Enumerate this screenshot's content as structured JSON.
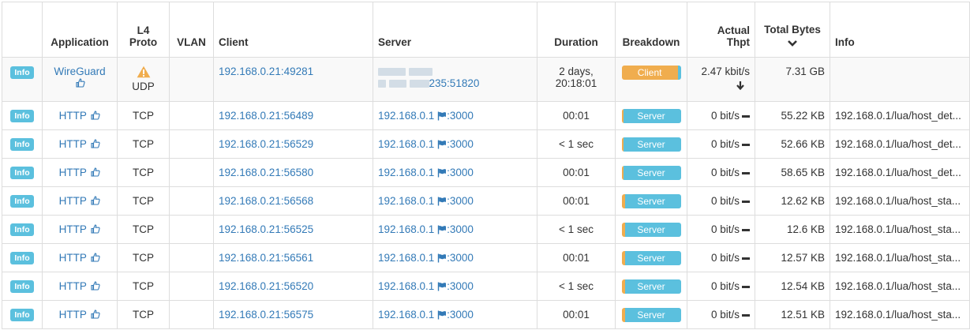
{
  "columns": {
    "application": "Application",
    "l4_proto_line1": "L4",
    "l4_proto_line2": "Proto",
    "vlan": "VLAN",
    "client": "Client",
    "server": "Server",
    "duration": "Duration",
    "breakdown": "Breakdown",
    "thpt_line1": "Actual",
    "thpt_line2": "Thpt",
    "total_bytes": "Total Bytes",
    "info": "Info"
  },
  "colors": {
    "info_button": "#5bc0de",
    "client_bar": "#f0ad4e",
    "server_bar": "#5bc0de",
    "link": "#337ab7",
    "warning": "#f0ad4e"
  },
  "flows": [
    {
      "info_button": "Info",
      "application": "WireGuard",
      "app_icon": "thumbs-up-icon",
      "proto_icon": "warning-icon",
      "proto": "UDP",
      "vlan": "",
      "client": "192.168.0.21:49281",
      "server_suffix": "235:51820",
      "duration_line1": "2 days,",
      "duration_line2": "20:18:01",
      "breakdown_label": "Client",
      "breakdown_client_pct": 95,
      "thpt": "2.47 kbit/s",
      "thpt_trend": "down",
      "total_bytes": "7.31 GB",
      "info": ""
    },
    {
      "info_button": "Info",
      "application": "HTTP",
      "app_icon": "thumbs-up-icon",
      "proto": "TCP",
      "vlan": "",
      "client": "192.168.0.21:56489",
      "server_host": "192.168.0.1",
      "server_port": ":3000",
      "duration": "00:01",
      "breakdown_label": "Server",
      "breakdown_client_pct": 3,
      "thpt": "0 bit/s",
      "thpt_trend": "flat",
      "total_bytes": "55.22 KB",
      "info": "192.168.0.1/lua/host_det..."
    },
    {
      "info_button": "Info",
      "application": "HTTP",
      "app_icon": "thumbs-up-icon",
      "proto": "TCP",
      "vlan": "",
      "client": "192.168.0.21:56529",
      "server_host": "192.168.0.1",
      "server_port": ":3000",
      "duration": "< 1 sec",
      "breakdown_label": "Server",
      "breakdown_client_pct": 3,
      "thpt": "0 bit/s",
      "thpt_trend": "flat",
      "total_bytes": "52.66 KB",
      "info": "192.168.0.1/lua/host_det..."
    },
    {
      "info_button": "Info",
      "application": "HTTP",
      "app_icon": "thumbs-up-icon",
      "proto": "TCP",
      "vlan": "",
      "client": "192.168.0.21:56580",
      "server_host": "192.168.0.1",
      "server_port": ":3000",
      "duration": "00:01",
      "breakdown_label": "Server",
      "breakdown_client_pct": 3,
      "thpt": "0 bit/s",
      "thpt_trend": "flat",
      "total_bytes": "58.65 KB",
      "info": "192.168.0.1/lua/host_det..."
    },
    {
      "info_button": "Info",
      "application": "HTTP",
      "app_icon": "thumbs-up-icon",
      "proto": "TCP",
      "vlan": "",
      "client": "192.168.0.21:56568",
      "server_host": "192.168.0.1",
      "server_port": ":3000",
      "duration": "00:01",
      "breakdown_label": "Server",
      "breakdown_client_pct": 6,
      "thpt": "0 bit/s",
      "thpt_trend": "flat",
      "total_bytes": "12.62 KB",
      "info": "192.168.0.1/lua/host_sta..."
    },
    {
      "info_button": "Info",
      "application": "HTTP",
      "app_icon": "thumbs-up-icon",
      "proto": "TCP",
      "vlan": "",
      "client": "192.168.0.21:56525",
      "server_host": "192.168.0.1",
      "server_port": ":3000",
      "duration": "< 1 sec",
      "breakdown_label": "Server",
      "breakdown_client_pct": 6,
      "thpt": "0 bit/s",
      "thpt_trend": "flat",
      "total_bytes": "12.6 KB",
      "info": "192.168.0.1/lua/host_sta..."
    },
    {
      "info_button": "Info",
      "application": "HTTP",
      "app_icon": "thumbs-up-icon",
      "proto": "TCP",
      "vlan": "",
      "client": "192.168.0.21:56561",
      "server_host": "192.168.0.1",
      "server_port": ":3000",
      "duration": "00:01",
      "breakdown_label": "Server",
      "breakdown_client_pct": 6,
      "thpt": "0 bit/s",
      "thpt_trend": "flat",
      "total_bytes": "12.57 KB",
      "info": "192.168.0.1/lua/host_sta..."
    },
    {
      "info_button": "Info",
      "application": "HTTP",
      "app_icon": "thumbs-up-icon",
      "proto": "TCP",
      "vlan": "",
      "client": "192.168.0.21:56520",
      "server_host": "192.168.0.1",
      "server_port": ":3000",
      "duration": "< 1 sec",
      "breakdown_label": "Server",
      "breakdown_client_pct": 6,
      "thpt": "0 bit/s",
      "thpt_trend": "flat",
      "total_bytes": "12.54 KB",
      "info": "192.168.0.1/lua/host_sta..."
    },
    {
      "info_button": "Info",
      "application": "HTTP",
      "app_icon": "thumbs-up-icon",
      "proto": "TCP",
      "vlan": "",
      "client": "192.168.0.21:56575",
      "server_host": "192.168.0.1",
      "server_port": ":3000",
      "duration": "00:01",
      "breakdown_label": "Server",
      "breakdown_client_pct": 6,
      "thpt": "0 bit/s",
      "thpt_trend": "flat",
      "total_bytes": "12.51 KB",
      "info": "192.168.0.1/lua/host_sta..."
    }
  ]
}
